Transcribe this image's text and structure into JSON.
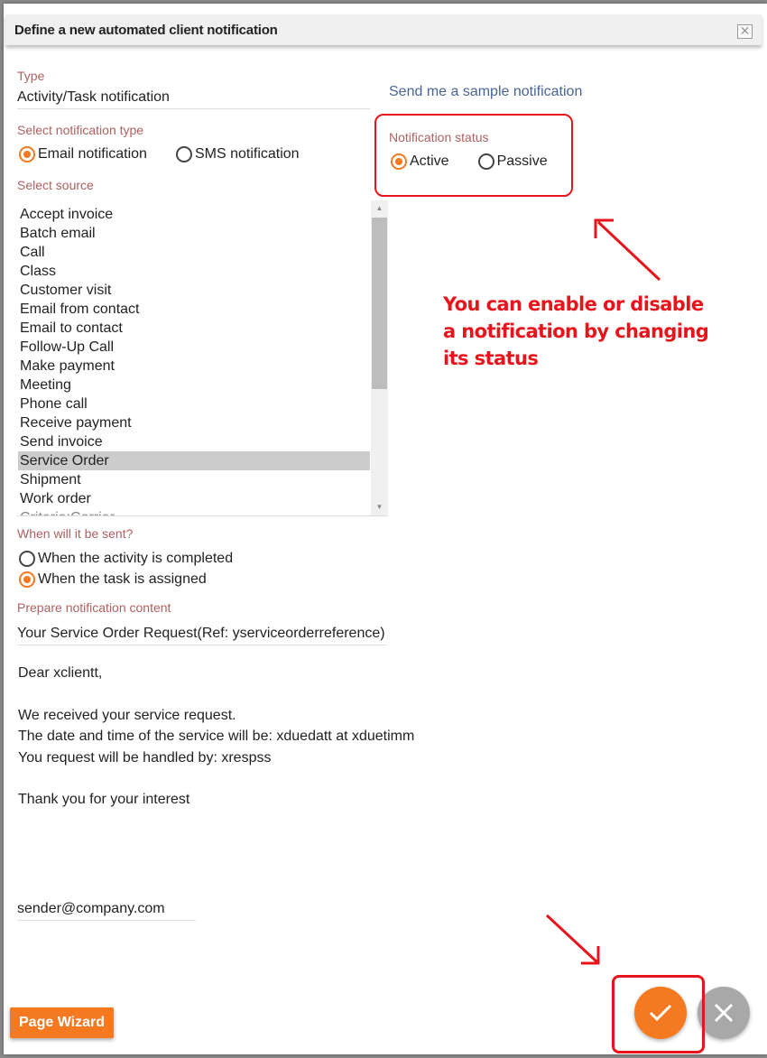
{
  "dialog": {
    "title": "Define a new automated client notification",
    "close_icon": "close-icon"
  },
  "type_field": {
    "label": "Type",
    "value": "Activity/Task notification"
  },
  "sample_link": "Send me a sample notification",
  "notification_type": {
    "label": "Select notification type",
    "options": [
      {
        "label": "Email notification",
        "checked": true
      },
      {
        "label": "SMS notification",
        "checked": false
      }
    ]
  },
  "notification_status": {
    "label": "Notification status",
    "options": [
      {
        "label": "Active",
        "checked": true
      },
      {
        "label": "Passive",
        "checked": false
      }
    ]
  },
  "source": {
    "label": "Select source",
    "items": [
      "Accept invoice",
      "Batch email",
      "Call",
      "Class",
      "Customer visit",
      "Email from contact",
      "Email to contact",
      "Follow-Up Call",
      "Make payment",
      "Meeting",
      "Phone call",
      "Receive payment",
      "Send invoice",
      "Service Order",
      "Shipment",
      "Work order",
      "Criteria:Carrier"
    ],
    "selected": "Service Order"
  },
  "send_timing": {
    "label": "When will it be sent?",
    "options": [
      {
        "label": "When the activity is completed",
        "checked": false
      },
      {
        "label": "When the task is assigned",
        "checked": true
      }
    ]
  },
  "content": {
    "label": "Prepare notification content",
    "subject": "Your Service Order Request(Ref: yserviceorderreference)",
    "body_lines": [
      "Dear xclientt,",
      "",
      "We received your service request.",
      "The date and time of the service will be: xduedatt at xduetimm",
      "You request will be handled by: xrespss",
      "",
      "Thank you for your interest"
    ],
    "sender": "sender@company.com"
  },
  "annotation": {
    "lines": [
      "You can enable or disable",
      "a notification by changing",
      "its status"
    ],
    "color": "#e8141c"
  },
  "footer": {
    "wizard_label": "Page Wizard",
    "confirm_icon": "check-icon",
    "cancel_icon": "close-icon"
  },
  "colors": {
    "accent": "#f47920",
    "label": "#b06060",
    "link": "#4a6496",
    "annotation": "#e8141c"
  }
}
